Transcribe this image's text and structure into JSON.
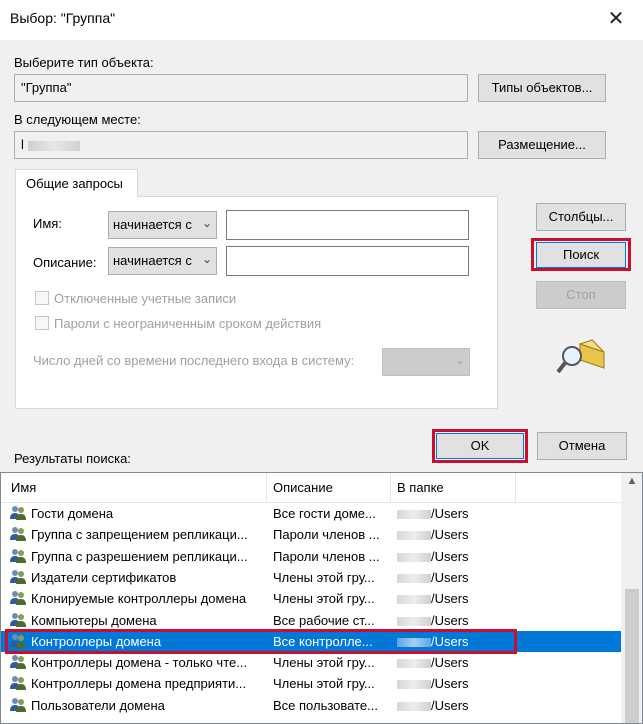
{
  "window": {
    "title": "Выбор: \"Группа\"",
    "close_glyph": "✕"
  },
  "object_type": {
    "label": "Выберите тип объекта:",
    "value": "\"Группа\"",
    "button": "Типы объектов..."
  },
  "location": {
    "label": "В следующем месте:",
    "value": "l",
    "button": "Размещение..."
  },
  "tab": {
    "label": "Общие запросы"
  },
  "query": {
    "name_label": "Имя:",
    "name_mode": "начинается с",
    "description_label": "Описание:",
    "description_mode": "начинается с",
    "disabled_accounts": "Отключенные учетные записи",
    "non_expiring": "Пароли с неограниченным сроком действия",
    "days_label": "Число дней со времени последнего входа в систему:"
  },
  "buttons": {
    "columns": "Столбцы...",
    "search": "Поиск",
    "stop": "Стоп",
    "ok": "OK",
    "cancel": "Отмена"
  },
  "results": {
    "label": "Результаты поиска:",
    "columns": [
      "Имя",
      "Описание",
      "В папке"
    ],
    "rows": [
      {
        "name": "Гости домена",
        "description": "Все гости доме...",
        "folder": "/Users",
        "selected": false
      },
      {
        "name": "Группа с запрещением репликаци...",
        "description": "Пароли членов ...",
        "folder": "/Users",
        "selected": false
      },
      {
        "name": "Группа с разрешением репликаци...",
        "description": "Пароли членов ...",
        "folder": "/Users",
        "selected": false
      },
      {
        "name": "Издатели сертификатов",
        "description": "Члены этой гру...",
        "folder": "/Users",
        "selected": false
      },
      {
        "name": "Клонируемые контроллеры домена",
        "description": "Члены этой гру...",
        "folder": "/Users",
        "selected": false
      },
      {
        "name": "Компьютеры домена",
        "description": "Все рабочие ст...",
        "folder": "/Users",
        "selected": false
      },
      {
        "name": "Контроллеры домена",
        "description": "Все контролле...",
        "folder": "/Users",
        "selected": true
      },
      {
        "name": "Контроллеры домена - только чте...",
        "description": "Члены этой гру...",
        "folder": "/Users",
        "selected": false
      },
      {
        "name": "Контроллеры домена предприяти...",
        "description": "Члены этой гру...",
        "folder": "/Users",
        "selected": false
      },
      {
        "name": "Пользователи домена",
        "description": "Все пользовате...",
        "folder": "/Users",
        "selected": false
      }
    ]
  },
  "colors": {
    "highlight": "#c8102e",
    "selection": "#0078d7",
    "window_bg": "#f0f0f0"
  },
  "icons": {
    "group": "group-users-icon",
    "search_illustration": "magnifier-icon"
  }
}
